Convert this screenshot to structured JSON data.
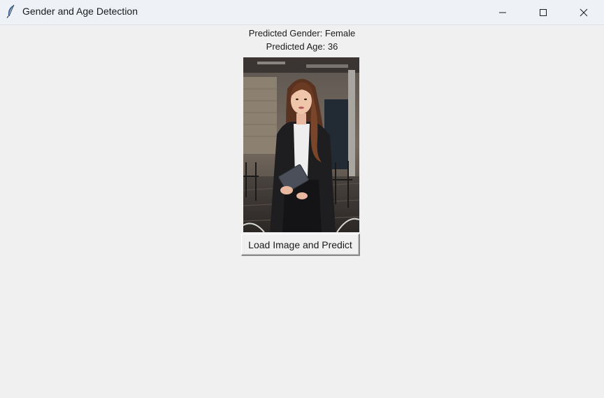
{
  "window": {
    "title": "Gender and Age Detection",
    "icon": "feather-icon",
    "controls": [
      "minimize-icon",
      "maximize-icon",
      "close-icon"
    ]
  },
  "results": {
    "gender_text": "Predicted Gender: Female",
    "age_text": "Predicted Age: 36"
  },
  "image": {
    "description_icon": "portrait-photo"
  },
  "actions": {
    "load_button_label": "Load Image and Predict"
  }
}
